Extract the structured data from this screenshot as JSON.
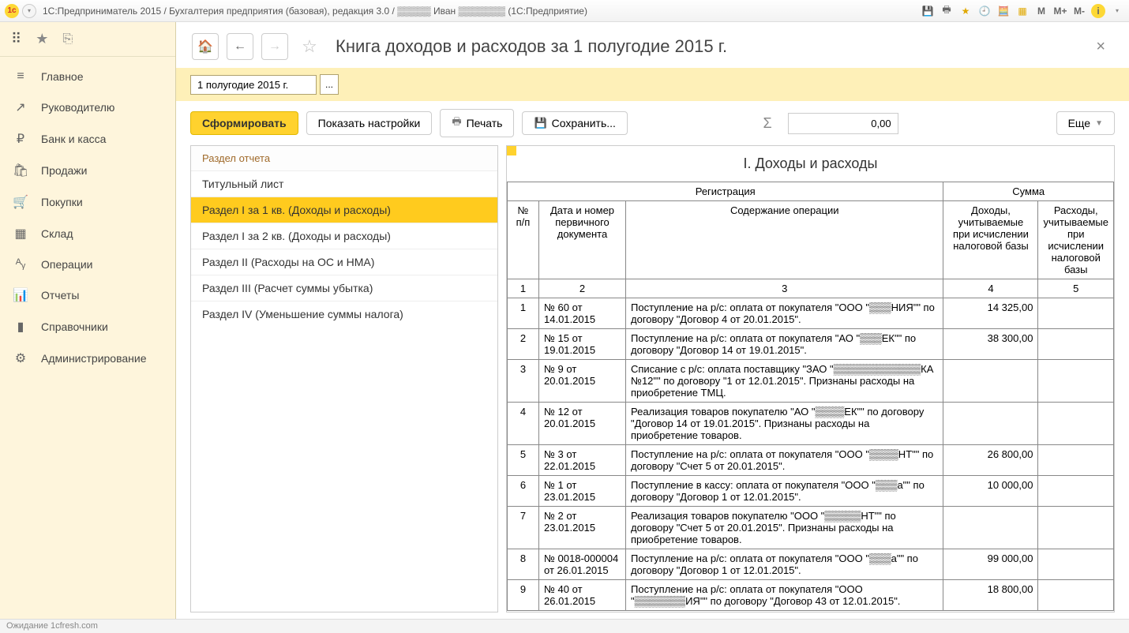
{
  "titlebar": {
    "text": "1С:Предприниматель 2015 / Бухгалтерия предприятия (базовая), редакция 3.0 / ▒▒▒▒▒ Иван ▒▒▒▒▒▒▒  (1С:Предприятие)",
    "m1": "M",
    "m2": "M+",
    "m3": "M-"
  },
  "nav": {
    "items": [
      {
        "icon": "≡",
        "label": "Главное"
      },
      {
        "icon": "↗",
        "label": "Руководителю"
      },
      {
        "icon": "₽",
        "label": "Банк и касса"
      },
      {
        "icon": "🛍",
        "label": "Продажи"
      },
      {
        "icon": "🛒",
        "label": "Покупки"
      },
      {
        "icon": "▦",
        "label": "Склад"
      },
      {
        "icon": "ᴬᵧ",
        "label": "Операции"
      },
      {
        "icon": "📊",
        "label": "Отчеты"
      },
      {
        "icon": "▮",
        "label": "Справочники"
      },
      {
        "icon": "⚙",
        "label": "Администрирование"
      }
    ]
  },
  "header": {
    "title": "Книга доходов и расходов за 1 полугодие 2015 г."
  },
  "period": {
    "value": "1 полугодие 2015 г.",
    "picker": "..."
  },
  "toolbar": {
    "form": "Сформировать",
    "settings": "Показать настройки",
    "print": "Печать",
    "save": "Сохранить...",
    "num": "0,00",
    "more": "Еще"
  },
  "sections": {
    "header": "Раздел отчета",
    "items": [
      "Титульный лист",
      "Раздел I за 1 кв. (Доходы и расходы)",
      "Раздел I за 2 кв. (Доходы и расходы)",
      "Раздел II (Расходы на ОС и НМА)",
      "Раздел III (Расчет суммы убытка)",
      "Раздел IV (Уменьшение суммы налога)"
    ],
    "selected_index": 1
  },
  "report": {
    "title": "I. Доходы и расходы",
    "columns": {
      "group_reg": "Регистрация",
      "group_sum": "Сумма",
      "npp": "№ п/п",
      "docdate": "Дата и номер первичного документа",
      "desc": "Содержание операции",
      "income": "Доходы, учитываемые при исчислении налоговой базы",
      "expense": "Расходы, учитываемые при исчислении налоговой базы",
      "colnums": [
        "1",
        "2",
        "3",
        "4",
        "5"
      ]
    },
    "rows": [
      {
        "n": "1",
        "doc": "№ 60 от 14.01.2015",
        "desc": "Поступление на р/с: оплата от покупателя \"ООО \"▒▒▒НИЯ\"\" по договору \"Договор 4 от 20.01.2015\".",
        "inc": "14 325,00",
        "exp": ""
      },
      {
        "n": "2",
        "doc": "№ 15 от 19.01.2015",
        "desc": "Поступление на р/с: оплата от покупателя \"АО \"▒▒▒ЕК\"\" по договору \"Договор 14 от 19.01.2015\".",
        "inc": "38 300,00",
        "exp": ""
      },
      {
        "n": "3",
        "doc": "№ 9 от 20.01.2015",
        "desc": "Списание с р/с: оплата поставщику \"ЗАО \"▒▒▒▒▒▒▒▒▒▒▒▒КА №12\"\" по договору \"1 от 12.01.2015\". Признаны расходы на приобретение ТМЦ.",
        "inc": "",
        "exp": ""
      },
      {
        "n": "4",
        "doc": "№ 12 от 20.01.2015",
        "desc": "Реализация товаров покупателю \"АО \"▒▒▒▒ЕК\"\" по договору \"Договор 14 от 19.01.2015\". Признаны расходы на приобретение товаров.",
        "inc": "",
        "exp": ""
      },
      {
        "n": "5",
        "doc": "№ 3 от 22.01.2015",
        "desc": "Поступление на р/с: оплата от покупателя \"ООО \"▒▒▒▒НТ\"\" по договору \"Счет 5 от 20.01.2015\".",
        "inc": "26 800,00",
        "exp": ""
      },
      {
        "n": "6",
        "doc": "№ 1 от 23.01.2015",
        "desc": "Поступление в кассу: оплата от покупателя \"ООО \"▒▒▒а\"\" по договору \"Договор 1 от 12.01.2015\".",
        "inc": "10 000,00",
        "exp": ""
      },
      {
        "n": "7",
        "doc": "№ 2 от 23.01.2015",
        "desc": "Реализация товаров покупателю \"ООО \"▒▒▒▒▒НТ\"\" по договору \"Счет 5 от 20.01.2015\". Признаны расходы на приобретение товаров.",
        "inc": "",
        "exp": ""
      },
      {
        "n": "8",
        "doc": "№ 0018-000004 от 26.01.2015",
        "desc": "Поступление на р/с: оплата от покупателя \"ООО \"▒▒▒а\"\" по договору \"Договор 1 от 12.01.2015\".",
        "inc": "99 000,00",
        "exp": ""
      },
      {
        "n": "9",
        "doc": "№ 40 от 26.01.2015",
        "desc": "Поступление на р/с: оплата от покупателя \"ООО \"▒▒▒▒▒▒▒ИЯ\"\" по договору \"Договор 43 от 12.01.2015\".",
        "inc": "18 800,00",
        "exp": ""
      }
    ]
  },
  "status": {
    "text": "Ожидание 1cfresh.com"
  }
}
